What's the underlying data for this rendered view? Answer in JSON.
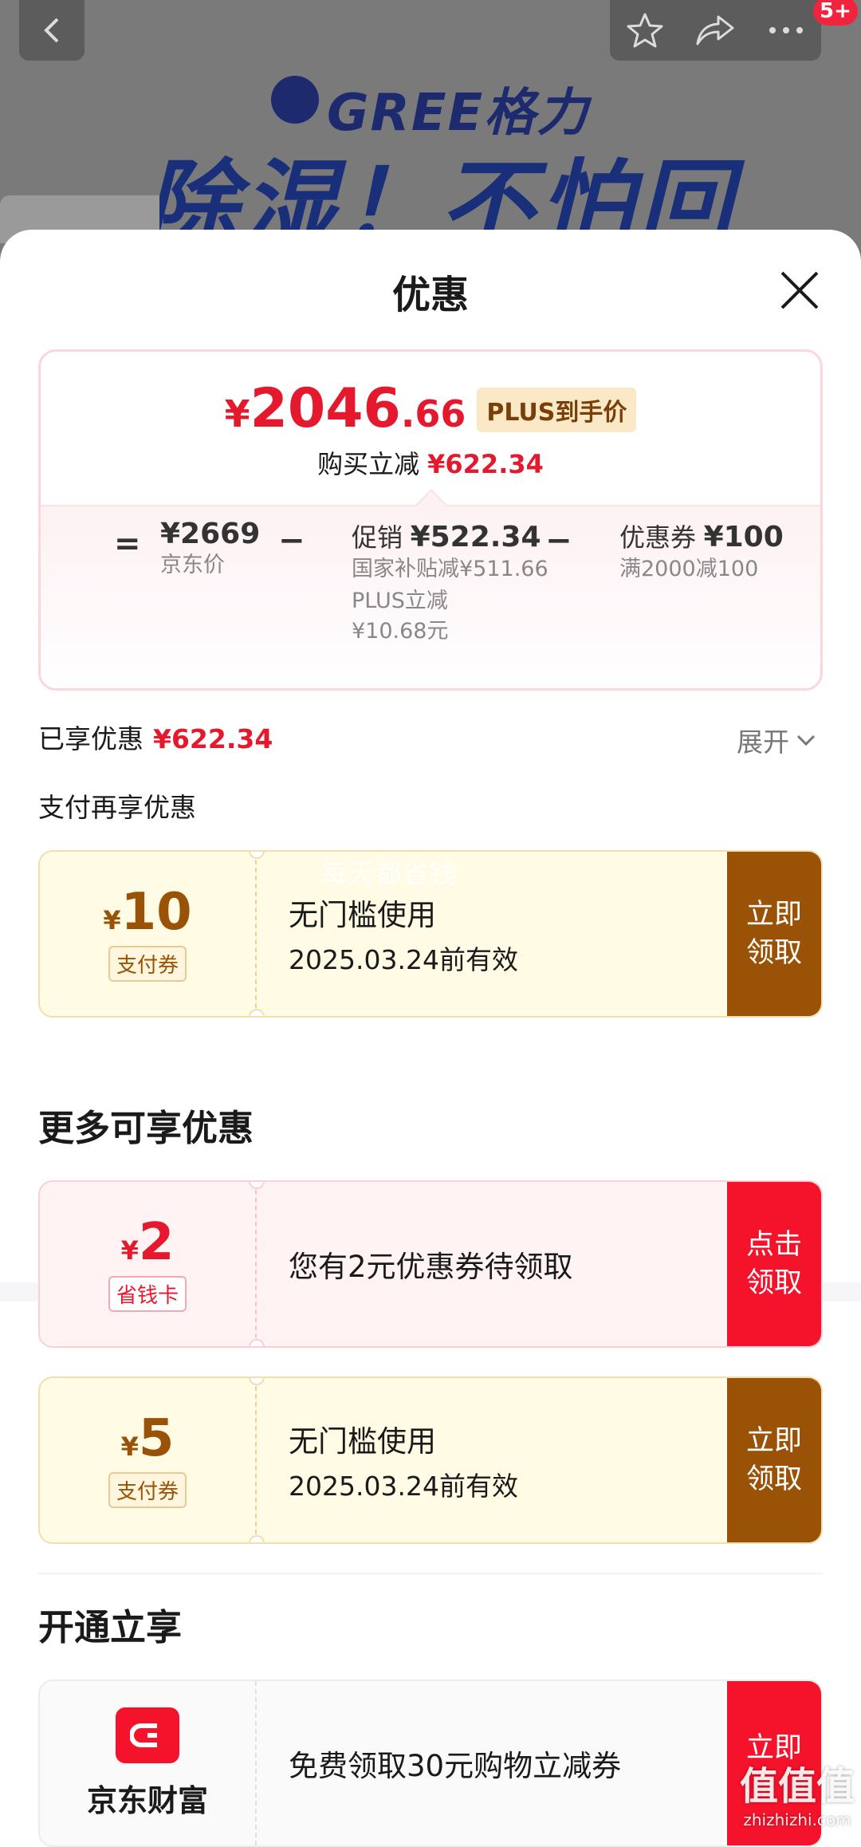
{
  "background": {
    "brand_logo": "GREE格力",
    "slogan": "除湿！不怕回",
    "badge_count": "5+"
  },
  "sheet": {
    "title": "优惠",
    "price": {
      "symbol": "¥",
      "integer": "2046",
      "decimal": ".66",
      "plus_tag": "PLUS到手价",
      "save_label": "购买立减",
      "save_amount": "¥622.34"
    },
    "breakdown": {
      "equals": "=",
      "minus": "−",
      "jd_price": "¥2669",
      "jd_price_label": "京东价",
      "promo_label": "促销",
      "promo_amount": "¥522.34",
      "promo_detail_1": "国家补贴减¥511.66",
      "promo_detail_2": "PLUS立减",
      "promo_detail_3": "¥10.68元",
      "coupon_label": "优惠券",
      "coupon_amount": "¥100",
      "coupon_detail": "满2000减100"
    },
    "enjoyed_label": "已享优惠",
    "enjoyed_amount": "¥622.34",
    "expand_label": "展开",
    "pay_more_label": "支付再享优惠",
    "watermark": "每天都省钱",
    "pay_coupon": {
      "symbol": "¥",
      "amount": "10",
      "tag": "支付券",
      "main": "无门槛使用",
      "date": "2025.03.24前有效",
      "button": "立即领取"
    },
    "more_title": "更多可享优惠",
    "more_coupons": [
      {
        "symbol": "¥",
        "amount": "2",
        "tag": "省钱卡",
        "main": "您有2元优惠券待领取",
        "button": "点击领取"
      },
      {
        "symbol": "¥",
        "amount": "5",
        "tag": "支付券",
        "main": "无门槛使用",
        "date": "2025.03.24前有效",
        "button": "立即领取"
      }
    ],
    "open_title": "开通立享",
    "open_item": {
      "name": "京东财富",
      "main": "免费领取30元购物立减券",
      "button": "立即"
    }
  },
  "site_watermark": {
    "big": "值值值",
    "small": "zhizhizhi.com"
  },
  "colors": {
    "accent_red": "#e5192e",
    "coupon_brown": "#9a5207",
    "button_red": "#f5132b"
  }
}
